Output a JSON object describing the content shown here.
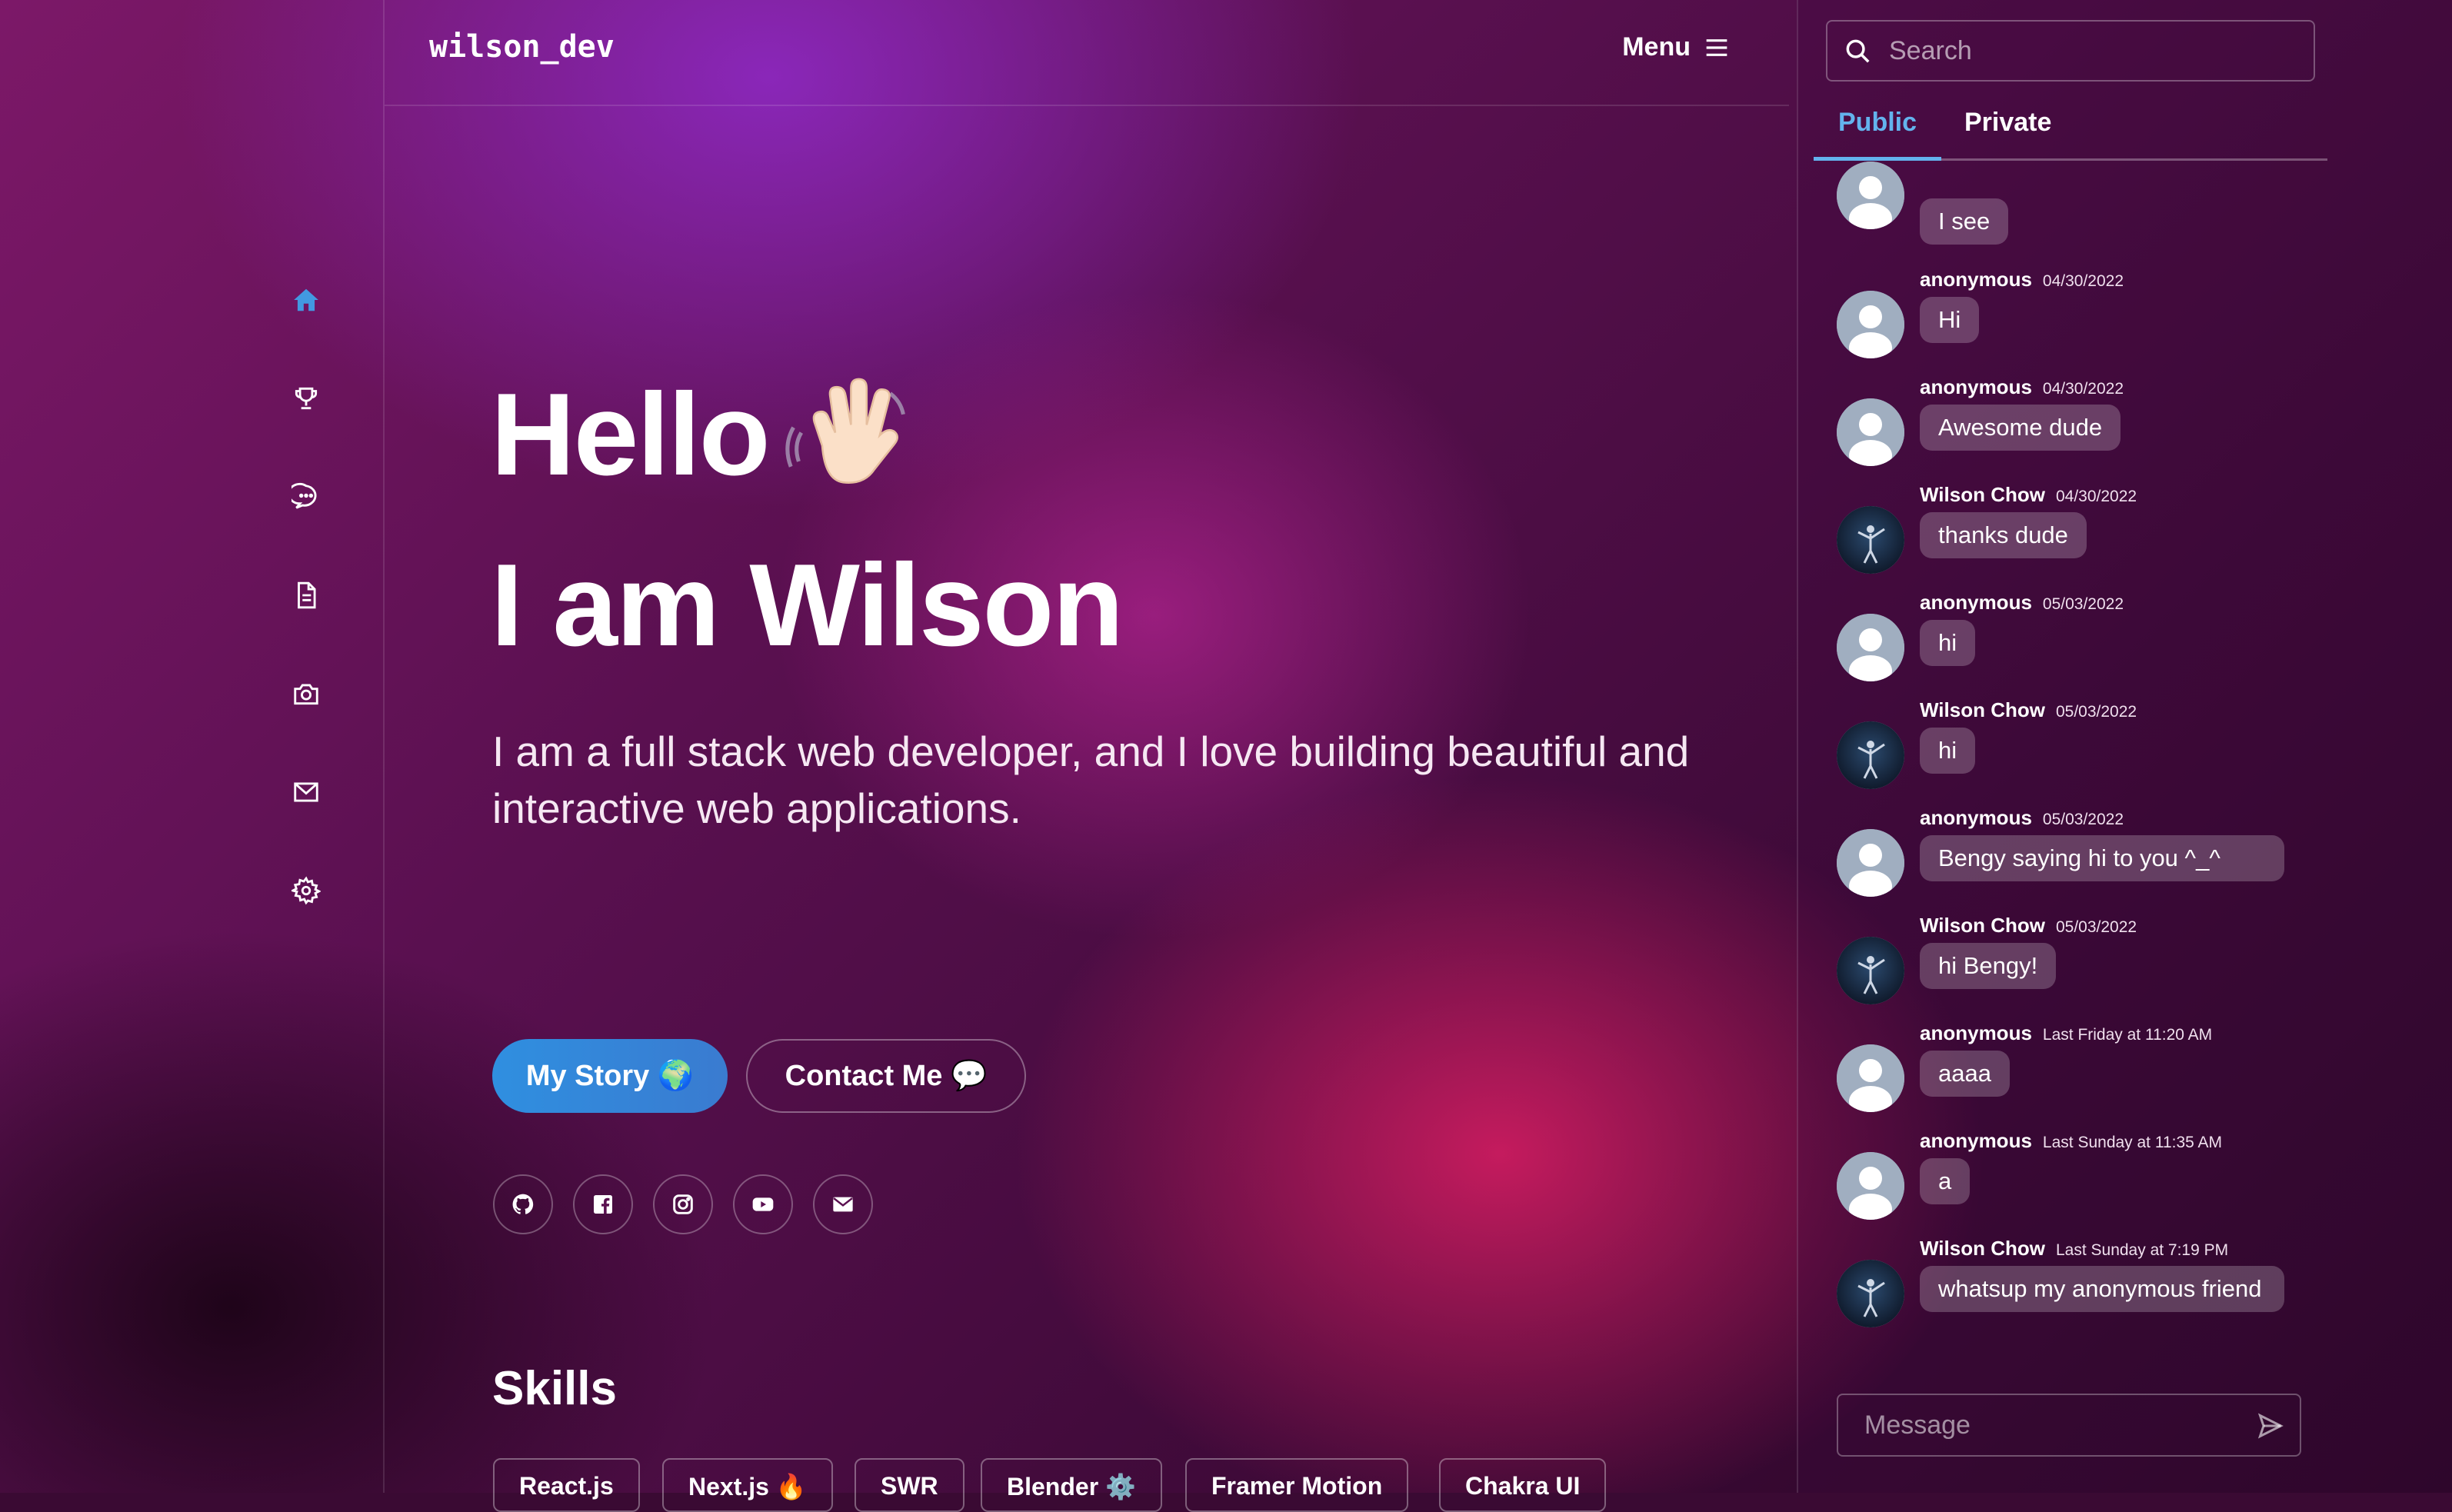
{
  "header": {
    "logo": "wilson_dev",
    "menu_label": "Menu"
  },
  "hero": {
    "hello": "Hello",
    "intro": "I am Wilson",
    "tagline": "I am a full stack web developer, and I love building beautiful and interactive web applications."
  },
  "buttons": {
    "story": "My Story 🌍",
    "contact": "Contact Me 💬"
  },
  "socials": [
    "github-icon",
    "facebook-icon",
    "instagram-icon",
    "youtube-icon",
    "mail-icon"
  ],
  "nav": [
    "home-icon",
    "trophy-icon",
    "chat-icon",
    "document-icon",
    "camera-icon",
    "mail-icon",
    "gear-icon"
  ],
  "skills": {
    "title": "Skills",
    "chips": [
      "React.js",
      "Next.js 🔥",
      "SWR",
      "Blender ⚙️",
      "Framer Motion",
      "Chakra UI"
    ]
  },
  "chat": {
    "search_placeholder": "Search",
    "tabs": [
      "Public",
      "Private"
    ],
    "active_tab": "Public",
    "messages": [
      {
        "name": "",
        "time": "",
        "text": "I see",
        "avatar": "default"
      },
      {
        "name": "anonymous",
        "time": "04/30/2022",
        "text": "Hi",
        "avatar": "default"
      },
      {
        "name": "anonymous",
        "time": "04/30/2022",
        "text": "Awesome dude",
        "avatar": "default"
      },
      {
        "name": "Wilson Chow",
        "time": "04/30/2022",
        "text": "thanks dude",
        "avatar": "photo"
      },
      {
        "name": "anonymous",
        "time": "05/03/2022",
        "text": "hi",
        "avatar": "default"
      },
      {
        "name": "Wilson Chow",
        "time": "05/03/2022",
        "text": "hi",
        "avatar": "photo"
      },
      {
        "name": "anonymous",
        "time": "05/03/2022",
        "text": "Bengy saying hi to you ^_^",
        "avatar": "default"
      },
      {
        "name": "Wilson Chow",
        "time": "05/03/2022",
        "text": "hi Bengy!",
        "avatar": "photo"
      },
      {
        "name": "anonymous",
        "time": "Last Friday at 11:20 AM",
        "text": "aaaa",
        "avatar": "default"
      },
      {
        "name": "anonymous",
        "time": "Last Sunday at 11:35 AM",
        "text": "a",
        "avatar": "default"
      },
      {
        "name": "Wilson Chow",
        "time": "Last Sunday at 7:19 PM",
        "text": "whatsup my anonymous friend",
        "avatar": "photo"
      }
    ],
    "composer_placeholder": "Message"
  },
  "colors": {
    "accent": "#63b3ed",
    "button": "#3182ce"
  }
}
